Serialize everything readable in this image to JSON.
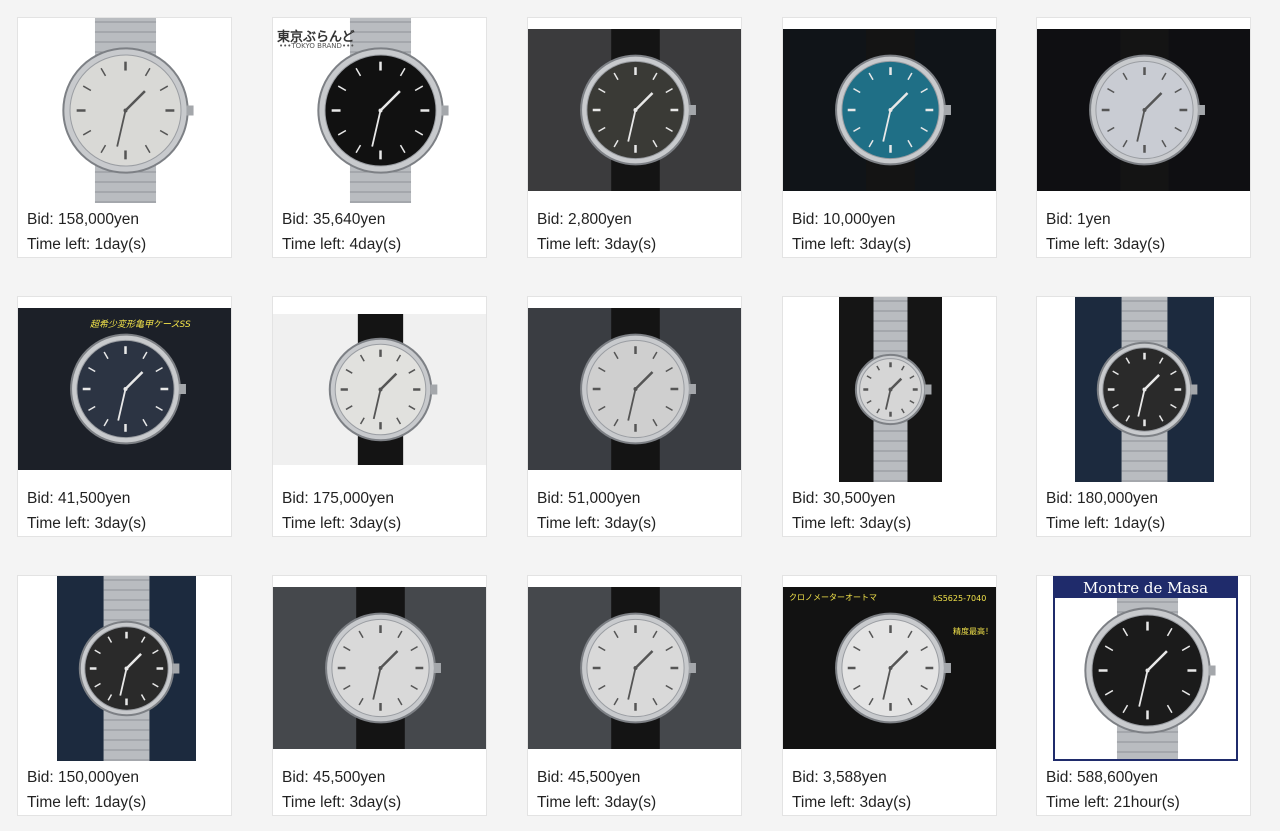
{
  "labels": {
    "bid_prefix": "Bid: ",
    "time_prefix": "Time left: "
  },
  "listings": [
    {
      "bid": "158,000yen",
      "time_left": "1day(s)",
      "bid_text": "Bid: 158,000yen",
      "time_text": "Time left: 1day(s)",
      "dial": "#d9d9d6",
      "bg": "#ffffff",
      "strap": "bracelet"
    },
    {
      "bid": "35,640yen",
      "time_left": "4day(s)",
      "bid_text": "Bid: 35,640yen",
      "time_text": "Time left: 4day(s)",
      "dial": "#111111",
      "bg": "#ffffff",
      "strap": "bracelet",
      "overlay": "東京ぶらんど",
      "overlay_sub": "•••TOKYO BRAND•••"
    },
    {
      "bid": "2,800yen",
      "time_left": "3day(s)",
      "bid_text": "Bid: 2,800yen",
      "time_text": "Time left: 3day(s)",
      "dial": "#3a3a36",
      "bg": "#3b3b3d",
      "strap": "leather"
    },
    {
      "bid": "10,000yen",
      "time_left": "3day(s)",
      "bid_text": "Bid: 10,000yen",
      "time_text": "Time left: 3day(s)",
      "dial": "#1f6f86",
      "bg": "#101418",
      "strap": "leather"
    },
    {
      "bid": "1yen",
      "time_left": "3day(s)",
      "bid_text": "Bid: 1yen",
      "time_text": "Time left: 3day(s)",
      "dial": "#c9ccd3",
      "bg": "#0f0f12",
      "strap": "leather"
    },
    {
      "bid": "41,500yen",
      "time_left": "3day(s)",
      "bid_text": "Bid: 41,500yen",
      "time_text": "Time left: 3day(s)",
      "dial": "#2c3443",
      "bg": "#1c2028",
      "strap": "none",
      "overlay": "超希少変形亀甲ケースSS"
    },
    {
      "bid": "175,000yen",
      "time_left": "3day(s)",
      "bid_text": "Bid: 175,000yen",
      "time_text": "Time left: 3day(s)",
      "dial": "#e1e1de",
      "bg": "#f0f0f0",
      "strap": "leather"
    },
    {
      "bid": "51,000yen",
      "time_left": "3day(s)",
      "bid_text": "Bid: 51,000yen",
      "time_text": "Time left: 3day(s)",
      "dial": "#cfcfcf",
      "bg": "#3a3d42",
      "strap": "leather"
    },
    {
      "bid": "30,500yen",
      "time_left": "3day(s)",
      "bid_text": "Bid: 30,500yen",
      "time_text": "Time left: 3day(s)",
      "dial": "#d6d6d6",
      "bg": "#151515",
      "strap": "bracelet"
    },
    {
      "bid": "180,000yen",
      "time_left": "1day(s)",
      "bid_text": "Bid: 180,000yen",
      "time_text": "Time left: 1day(s)",
      "dial": "#2a2a2a",
      "bg": "#1c2a3e",
      "strap": "bracelet"
    },
    {
      "bid": "150,000yen",
      "time_left": "1day(s)",
      "bid_text": "Bid: 150,000yen",
      "time_text": "Time left: 1day(s)",
      "dial": "#2a2a2a",
      "bg": "#1c2a3e",
      "strap": "bracelet"
    },
    {
      "bid": "45,500yen",
      "time_left": "3day(s)",
      "bid_text": "Bid: 45,500yen",
      "time_text": "Time left: 3day(s)",
      "dial": "#d9d9d9",
      "bg": "#45484c",
      "strap": "leather"
    },
    {
      "bid": "45,500yen",
      "time_left": "3day(s)",
      "bid_text": "Bid: 45,500yen",
      "time_text": "Time left: 3day(s)",
      "dial": "#d9d9d9",
      "bg": "#45484c",
      "strap": "leather"
    },
    {
      "bid": "3,588yen",
      "time_left": "3day(s)",
      "bid_text": "Bid: 3,588yen",
      "time_text": "Time left: 3day(s)",
      "dial": "#e4e4e4",
      "bg": "#121212",
      "strap": "none",
      "overlay": "クロノメーターオートマ",
      "overlay_right": "kS5625-7040",
      "overlay_mid": "精度最高！"
    },
    {
      "bid": "588,600yen",
      "time_left": "21hour(s)",
      "bid_text": "Bid: 588,600yen",
      "time_text": "Time left: 21hour(s)",
      "dial": "#1b1b1b",
      "bg": "#ffffff",
      "strap": "bracelet",
      "overlay": "Montre de Masa"
    }
  ]
}
